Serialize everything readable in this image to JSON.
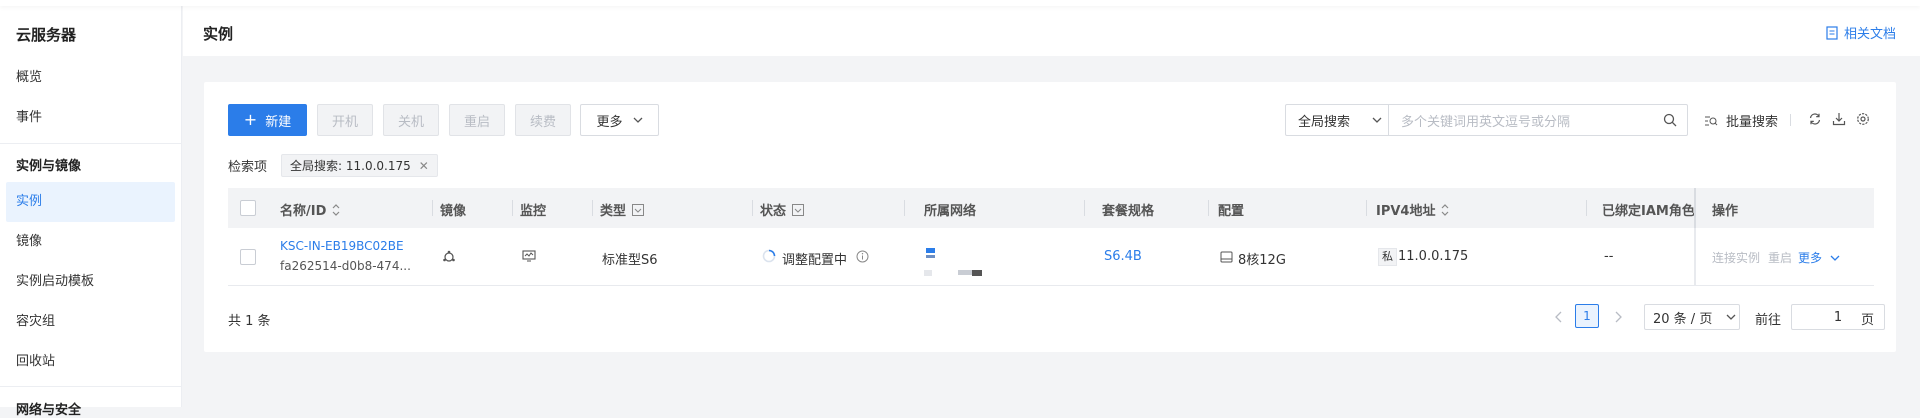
{
  "sidebar": {
    "title": "云服务器",
    "items": [
      {
        "label": "概览"
      },
      {
        "label": "事件"
      },
      {
        "label": "实例与镜像"
      },
      {
        "label": "实例"
      },
      {
        "label": "镜像"
      },
      {
        "label": "实例启动模板"
      },
      {
        "label": "容灾组"
      },
      {
        "label": "回收站"
      },
      {
        "label": "网络与安全"
      }
    ]
  },
  "header": {
    "title": "实例",
    "doc_link": "相关文档"
  },
  "toolbar": {
    "new_label": "新建",
    "start_label": "开机",
    "stop_label": "关机",
    "restart_label": "重启",
    "renew_label": "续费",
    "more_label": "更多",
    "search_scope": "全局搜索",
    "search_placeholder": "多个关键词用英文逗号或分隔",
    "batch_search": "批量搜索"
  },
  "filter": {
    "label": "检索项",
    "tag": "全局搜索: 11.0.0.175"
  },
  "table": {
    "headers": {
      "name": "名称/ID",
      "image": "镜像",
      "monitor": "监控",
      "type": "类型",
      "status": "状态",
      "network": "所属网络",
      "package": "套餐规格",
      "config": "配置",
      "ipv4": "IPV4地址",
      "iam": "已绑定IAM角色",
      "ops": "操作"
    },
    "rows": [
      {
        "name": "KSC-IN-EB19BC02BE",
        "id": "fa262514-d0b8-474...",
        "type": "标准型S6",
        "status": "调整配置中",
        "package": "S6.4B",
        "config": "8核12G",
        "ip_tag": "私",
        "ipv4": "11.0.0.175",
        "iam": "--",
        "op_connect": "连接实例",
        "op_restart": "重启",
        "op_more": "更多"
      }
    ]
  },
  "pagination": {
    "total": "共 1 条",
    "current_page": "1",
    "page_size": "20 条 / 页",
    "goto_label": "前往",
    "goto_value": "1",
    "page_suffix": "页"
  },
  "colors": {
    "accent": "#2b7de9",
    "disabled_text": "#b8bcc4",
    "header_bg": "#f2f3f5"
  }
}
